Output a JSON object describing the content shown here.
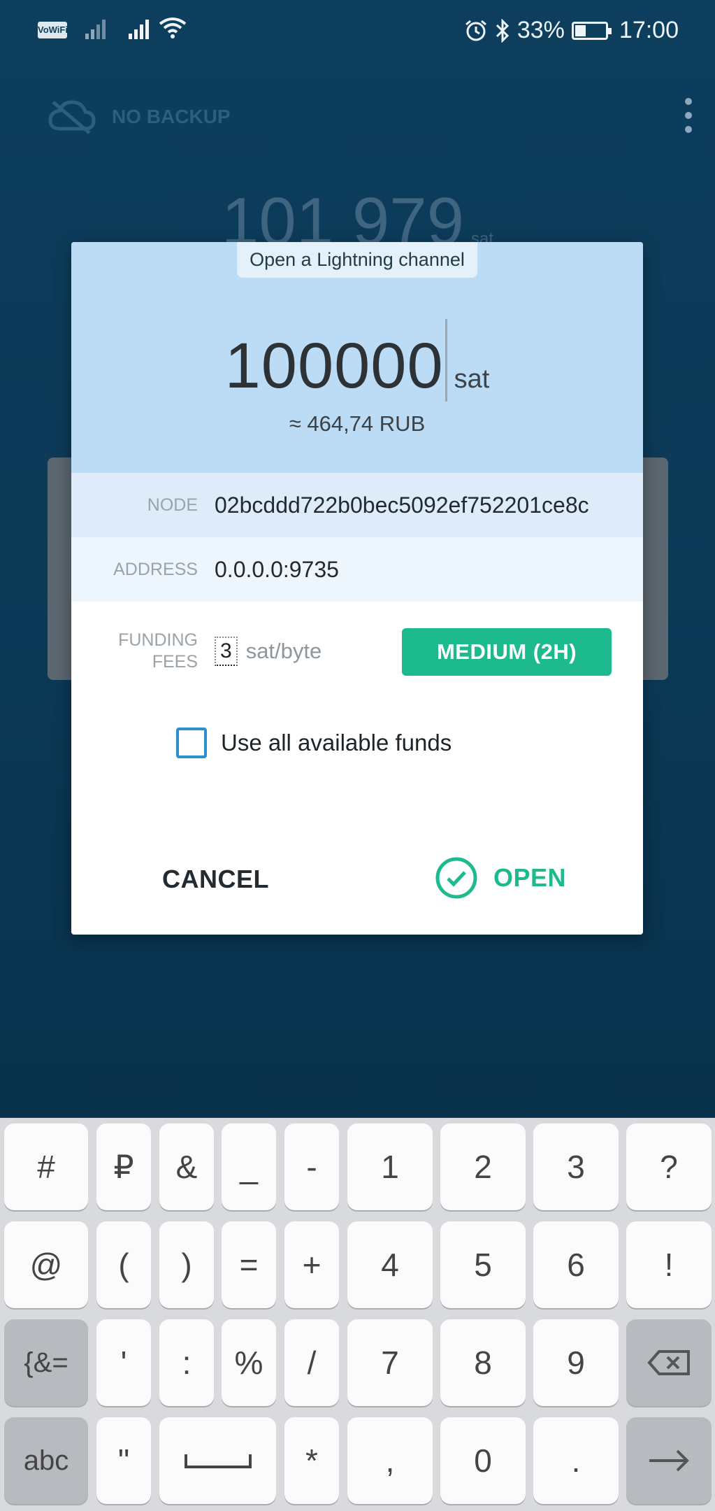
{
  "status_bar": {
    "wifi_calling": "VoWiFi",
    "battery_percent": "33%",
    "battery_level": 0.33,
    "time": "17:00"
  },
  "background_app": {
    "backup_status": "NO BACKUP",
    "balance": "101 979",
    "balance_unit": "sat"
  },
  "dialog": {
    "title": "Open a Lightning channel",
    "amount": "100000",
    "amount_unit": "sat",
    "fiat_equivalent": "≈ 464,74 RUB",
    "node_label": "NODE",
    "node_value": "02bcddd722b0bec5092ef752201ce8c",
    "address_label": "ADDRESS",
    "address_value": "0.0.0.0:9735",
    "funding_label_1": "FUNDING",
    "funding_label_2": "FEES",
    "fee_value": "3",
    "fee_unit": "sat/byte",
    "fee_speed": "MEDIUM (2H)",
    "use_all_funds_label": "Use all available funds",
    "cancel_label": "CANCEL",
    "open_label": "OPEN"
  },
  "keyboard": {
    "rows": [
      [
        "#",
        "₽",
        "&",
        "_",
        "-",
        "1",
        "2",
        "3",
        "?"
      ],
      [
        "@",
        "(",
        ")",
        "=",
        "+",
        "4",
        "5",
        "6",
        "!"
      ],
      [
        "{&=",
        "'",
        ":",
        "%",
        "/",
        "7",
        "8",
        "9",
        "backspace"
      ],
      [
        "abc",
        "\"",
        "space",
        "*",
        ",",
        "0",
        ".",
        "enter"
      ]
    ]
  },
  "colors": {
    "accent_green": "#1cba8d",
    "dialog_header": "#bcdcf6",
    "checkbox_blue": "#2a8fcf",
    "background_navy": "#0d3e5d"
  }
}
